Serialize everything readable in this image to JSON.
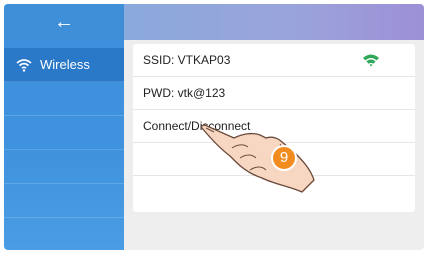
{
  "header": {
    "back_icon": "back-arrow-icon"
  },
  "sidebar": {
    "items": [
      {
        "label": "Wireless",
        "icon": "wifi-icon",
        "active": true
      }
    ]
  },
  "network": {
    "ssid": "SSID: VTKAP03",
    "password": "PWD: vtk@123",
    "action": "Connect/Disconnect",
    "signal_icon": "wifi-icon"
  },
  "step_badge": "9",
  "colors": {
    "sidebar": "#3f93de",
    "sidebar_active": "#2a78c8",
    "badge": "#f28c1e",
    "wifi_signal": "#2ea858"
  }
}
